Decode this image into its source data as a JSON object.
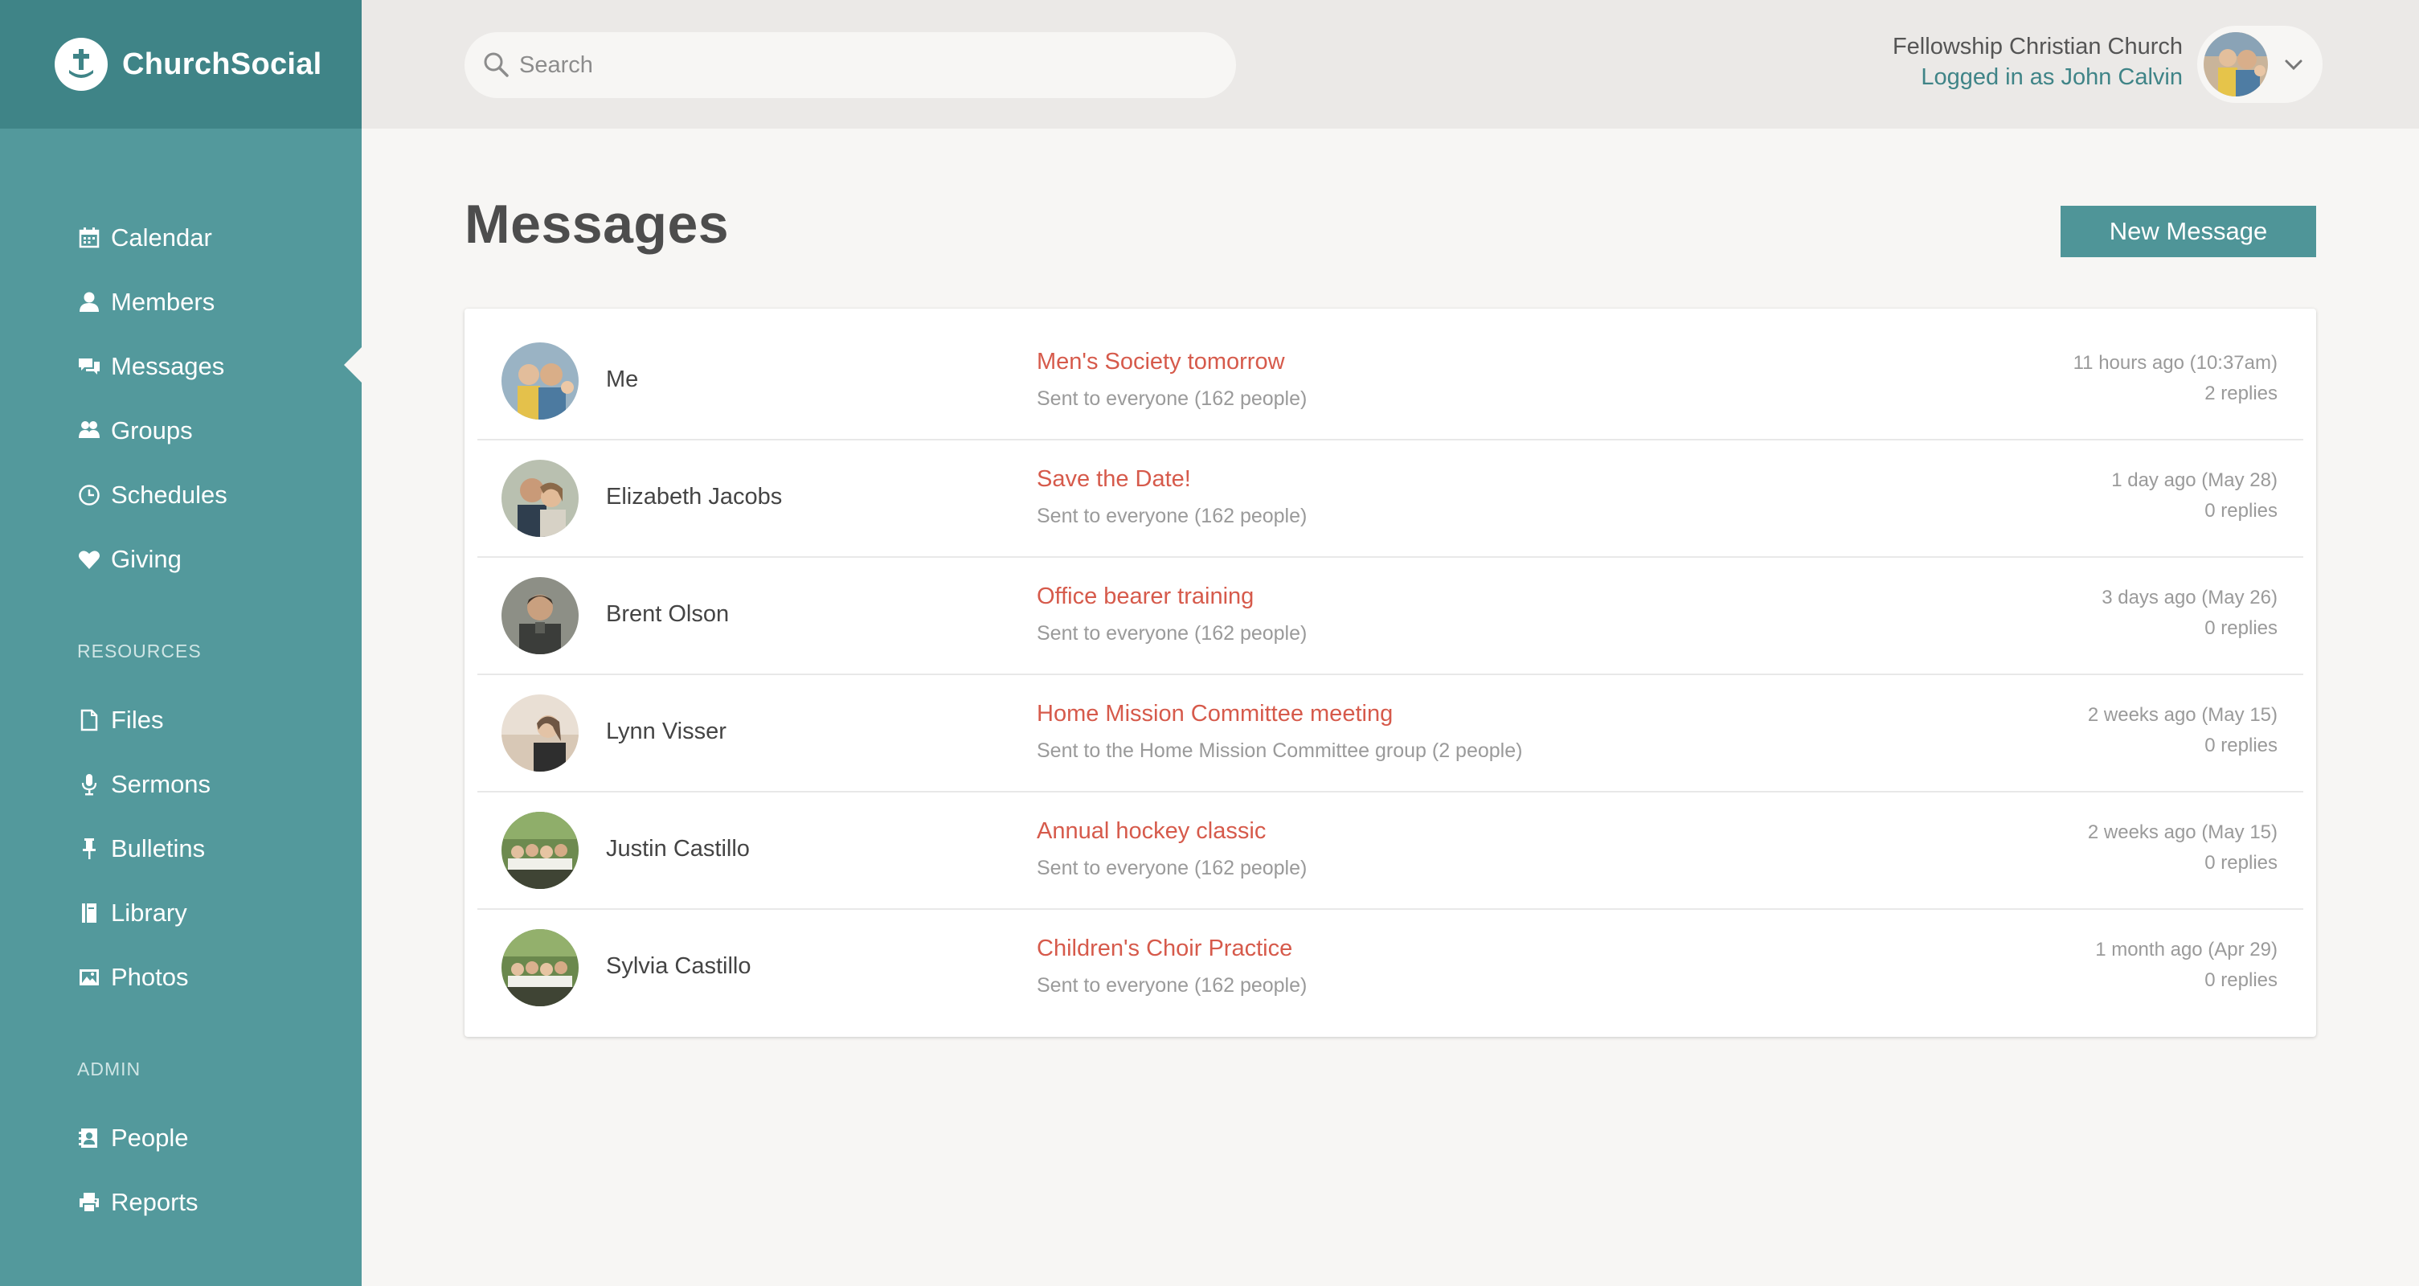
{
  "app": {
    "name": "ChurchSocial",
    "brand_color": "#3f8487",
    "sidebar_color": "#53999c",
    "accent_color": "#d65a4b"
  },
  "sidebar": {
    "main_items": [
      {
        "label": "Calendar",
        "icon": "calendar-icon"
      },
      {
        "label": "Members",
        "icon": "person-icon"
      },
      {
        "label": "Messages",
        "icon": "chat-bubbles-icon",
        "active": true
      },
      {
        "label": "Groups",
        "icon": "group-icon"
      },
      {
        "label": "Schedules",
        "icon": "clock-icon"
      },
      {
        "label": "Giving",
        "icon": "heart-icon"
      }
    ],
    "resources_heading": "RESOURCES",
    "resource_items": [
      {
        "label": "Files",
        "icon": "file-icon"
      },
      {
        "label": "Sermons",
        "icon": "microphone-icon"
      },
      {
        "label": "Bulletins",
        "icon": "pushpin-icon"
      },
      {
        "label": "Library",
        "icon": "book-icon"
      },
      {
        "label": "Photos",
        "icon": "picture-icon"
      }
    ],
    "admin_heading": "ADMIN",
    "admin_items": [
      {
        "label": "People",
        "icon": "contact-card-icon"
      },
      {
        "label": "Reports",
        "icon": "printer-icon"
      }
    ]
  },
  "header": {
    "search_placeholder": "Search",
    "org_name": "Fellowship Christian Church",
    "logged_in_text": "Logged in as John Calvin"
  },
  "main": {
    "title": "Messages",
    "new_message_label": "New Message",
    "messages": [
      {
        "sender": "Me",
        "subject": "Men's Society tomorrow",
        "recipients": "Sent to everyone (162 people)",
        "time": "11 hours ago (10:37am)",
        "replies": "2 replies"
      },
      {
        "sender": "Elizabeth Jacobs",
        "subject": "Save the Date!",
        "recipients": "Sent to everyone (162 people)",
        "time": "1 day ago (May 28)",
        "replies": "0 replies"
      },
      {
        "sender": "Brent Olson",
        "subject": "Office bearer training",
        "recipients": "Sent to everyone (162 people)",
        "time": "3 days ago (May 26)",
        "replies": "0 replies"
      },
      {
        "sender": "Lynn Visser",
        "subject": "Home Mission Committee meeting",
        "recipients": "Sent to the Home Mission Committee group (2 people)",
        "time": "2 weeks ago (May 15)",
        "replies": "0 replies"
      },
      {
        "sender": "Justin Castillo",
        "subject": "Annual hockey classic",
        "recipients": "Sent to everyone (162 people)",
        "time": "2 weeks ago (May 15)",
        "replies": "0 replies"
      },
      {
        "sender": "Sylvia Castillo",
        "subject": "Children's Choir Practice",
        "recipients": "Sent to everyone (162 people)",
        "time": "1 month ago (Apr 29)",
        "replies": "0 replies"
      }
    ]
  }
}
